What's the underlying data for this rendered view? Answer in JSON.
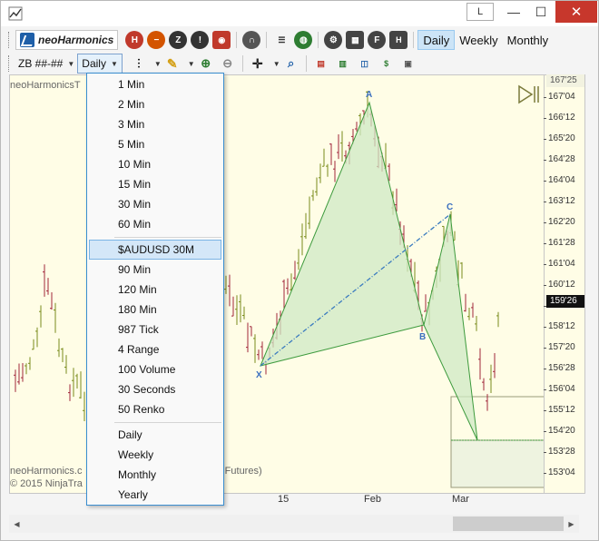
{
  "titlebar": {
    "btn_l": "L",
    "minimize": "—",
    "maximize": "☐",
    "close": "✕"
  },
  "toolbar": {
    "brand": "neoHarmonics",
    "timeframes": [
      "Daily",
      "Weekly",
      "Monthly"
    ],
    "active_timeframe": "Daily",
    "symbol": "ZB ##-##",
    "timeframe_dropdown": "Daily"
  },
  "chart": {
    "title": "neoHarmonicsT",
    "footer1": "neoHarmonics.c",
    "footer2": "© 2015 NinjaTra",
    "footer3": "ds Futures)",
    "y_ticks": [
      "167'04",
      "166'12",
      "165'20",
      "164'28",
      "164'04",
      "163'12",
      "162'20",
      "161'28",
      "161'04",
      "160'12",
      "159'04",
      "158'12",
      "157'20",
      "156'28",
      "156'04",
      "155'12",
      "154'20",
      "153'28",
      "153'04"
    ],
    "price_top": "167'25",
    "price_last": "159'26",
    "x_ticks": [
      "15",
      "Feb",
      "Mar"
    ],
    "pattern_points": [
      "A",
      "B",
      "C",
      "X"
    ],
    "colors": {
      "background": "#fffde6",
      "pattern_fill": "#cfe8c4",
      "pattern_line": "#3c9a3c",
      "dash_line": "#3b7bbf",
      "up_bar": "#7a8c1c",
      "down_bar": "#a0263a"
    }
  },
  "menu": {
    "groups": [
      [
        "1 Min",
        "2 Min",
        "3 Min",
        "5 Min",
        "10 Min",
        "15 Min",
        "30 Min",
        "60 Min"
      ],
      [
        "$AUDUSD 30M",
        "90 Min",
        "120 Min",
        "180 Min",
        "987 Tick",
        "4 Range",
        "100 Volume",
        "30 Seconds",
        "50 Renko"
      ],
      [
        "Daily",
        "Weekly",
        "Monthly",
        "Yearly"
      ]
    ],
    "highlighted": "$AUDUSD 30M"
  },
  "scrollbar": {
    "left_arrow": "◀",
    "right_arrow": "▶"
  }
}
